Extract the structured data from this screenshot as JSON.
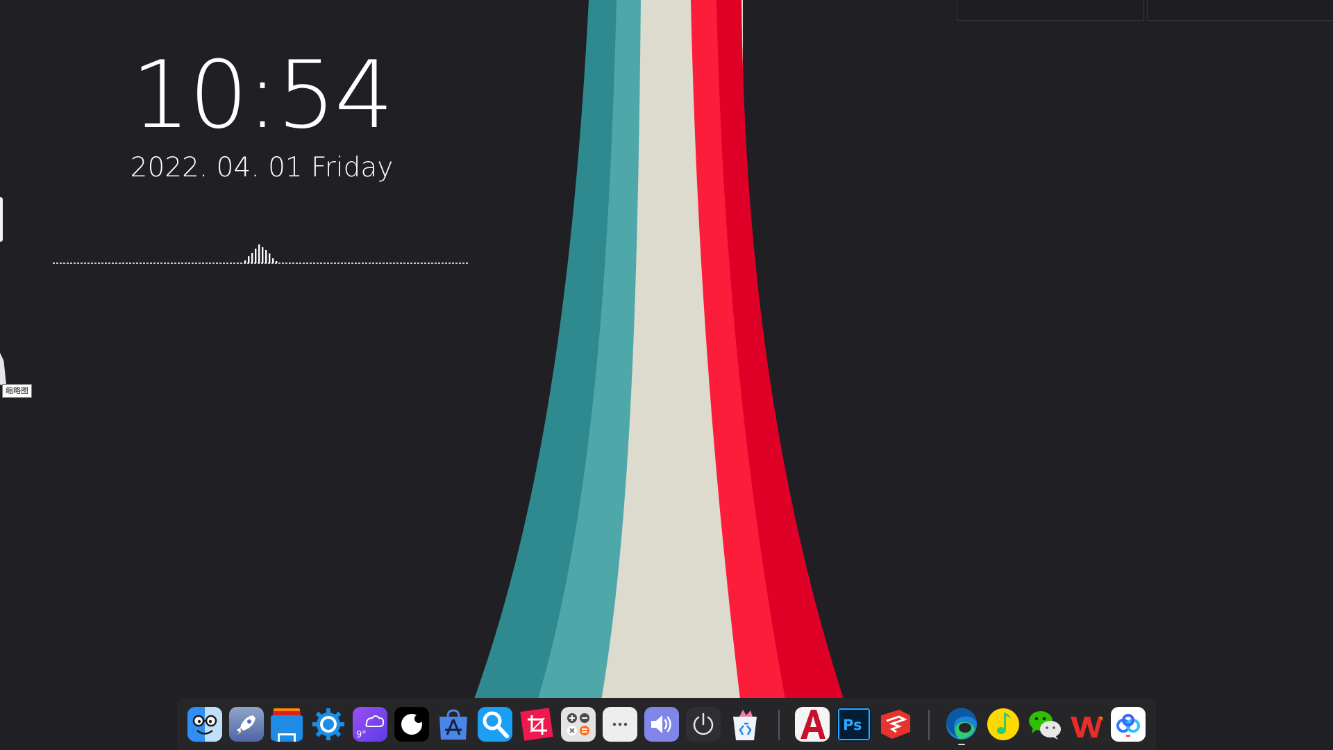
{
  "clock": {
    "time": "10:54",
    "date": "2022. 04. 01  Friday"
  },
  "tooltip": "缩略图",
  "weather": {
    "temperature": "9°"
  },
  "colors": {
    "background": "#1f1f24",
    "stripe_teal_dark": "#2e8a8f",
    "stripe_teal_light": "#4ea7a9",
    "stripe_cream": "#dcdbcd",
    "stripe_red_light": "#fc1d3b",
    "stripe_red_dark": "#de0026"
  },
  "dock": {
    "items": [
      {
        "icon": "finder-icon"
      },
      {
        "icon": "launchpad-rocket-icon"
      },
      {
        "icon": "file-explorer-icon"
      },
      {
        "icon": "settings-gear-icon"
      },
      {
        "icon": "weather-icon"
      },
      {
        "icon": "circle-app-icon"
      },
      {
        "icon": "app-store-icon"
      },
      {
        "icon": "search-icon"
      },
      {
        "icon": "screenshot-crop-icon"
      },
      {
        "icon": "calculator-icon"
      },
      {
        "icon": "more-dots-icon"
      },
      {
        "icon": "volume-icon"
      },
      {
        "icon": "power-icon"
      },
      {
        "icon": "recycle-bin-icon"
      },
      {
        "icon": "autocad-icon"
      },
      {
        "icon": "photoshop-icon"
      },
      {
        "icon": "sketchup-icon"
      },
      {
        "icon": "edge-browser-icon"
      },
      {
        "icon": "qq-music-icon"
      },
      {
        "icon": "wechat-icon"
      },
      {
        "icon": "wps-office-icon"
      },
      {
        "icon": "baidu-netdisk-icon"
      }
    ]
  }
}
